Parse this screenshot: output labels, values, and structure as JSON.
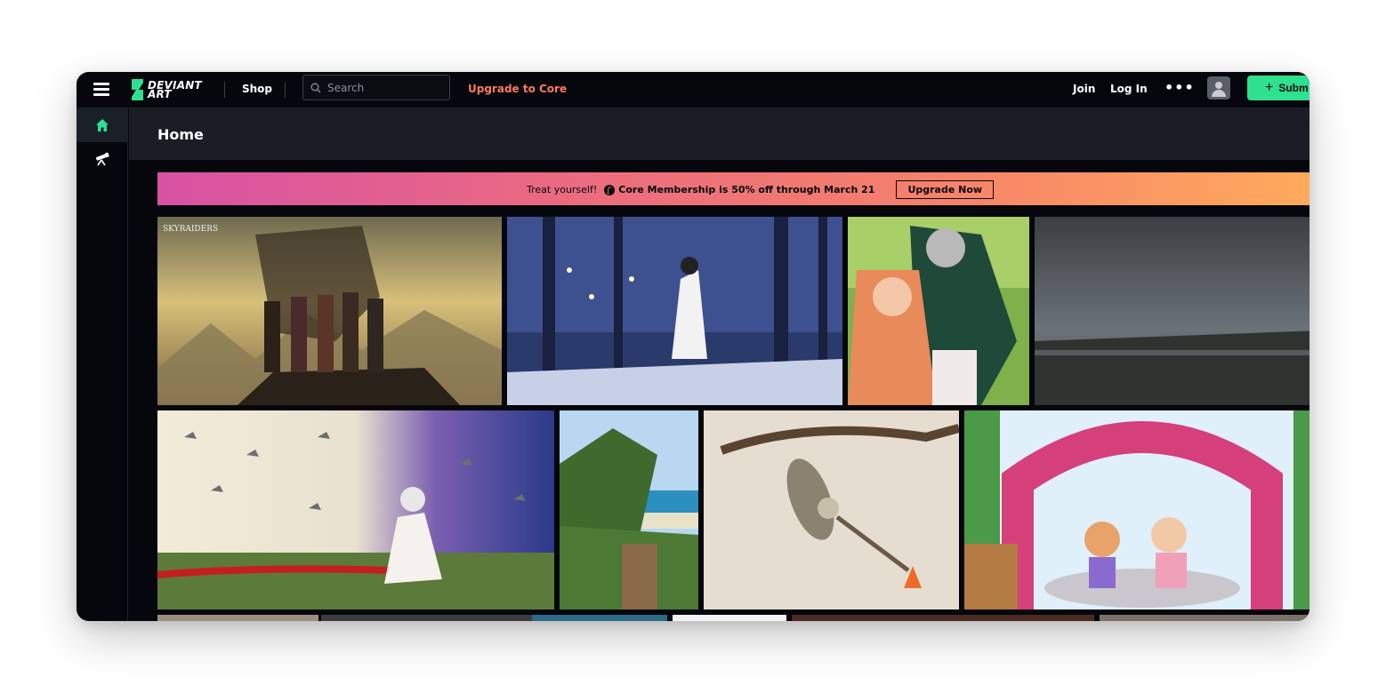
{
  "topbar": {
    "logo_line1": "DEVIANT",
    "logo_line2": "ART",
    "shop_label": "Shop",
    "search_placeholder": "Search",
    "upgrade_label": "Upgrade to Core",
    "join_label": "Join",
    "login_label": "Log In",
    "more_label": "•••",
    "submit_label": "Subm"
  },
  "sidebar": {
    "items": [
      {
        "name": "home",
        "icon": "home-icon",
        "active": true
      },
      {
        "name": "explore",
        "icon": "telescope-icon",
        "active": false
      }
    ]
  },
  "main": {
    "title": "Home"
  },
  "promo": {
    "lead": "Treat yourself!",
    "offer": "Core Membership is 50% off through March 21",
    "button_label": "Upgrade Now"
  },
  "colors": {
    "accent_green": "#2fe08f",
    "upgrade_orange": "#ff7a59",
    "background": "#06070d"
  }
}
